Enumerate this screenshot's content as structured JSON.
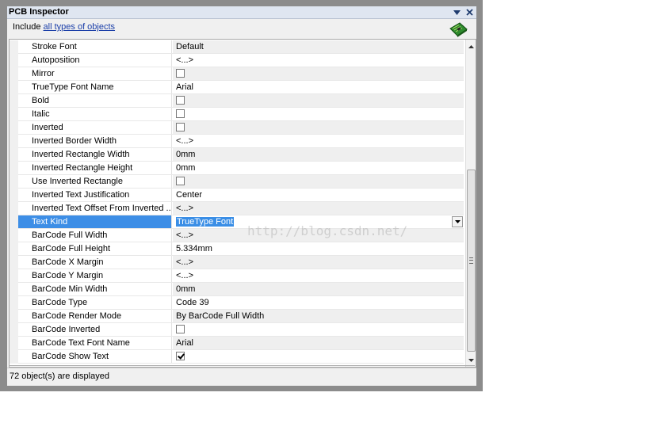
{
  "window": {
    "title": "PCB Inspector"
  },
  "include": {
    "prefix": "Include",
    "link": "all types of objects"
  },
  "icons": {
    "menu": "dropdown-arrow-icon",
    "close": "close-icon",
    "pcb": "pcb-board-icon"
  },
  "rows": [
    {
      "name": "Stroke Font",
      "value": "Default"
    },
    {
      "name": "Autoposition",
      "value": "<...>"
    },
    {
      "name": "Mirror",
      "check": false
    },
    {
      "name": "TrueType Font Name",
      "value": "Arial"
    },
    {
      "name": "Bold",
      "check": false
    },
    {
      "name": "Italic",
      "check": false
    },
    {
      "name": "Inverted",
      "check": false
    },
    {
      "name": "Inverted Border Width",
      "value": "<...>"
    },
    {
      "name": "Inverted Rectangle Width",
      "value": "0mm"
    },
    {
      "name": "Inverted Rectangle Height",
      "value": "0mm"
    },
    {
      "name": "Use Inverted Rectangle",
      "check": false
    },
    {
      "name": "Inverted Text Justification",
      "value": "Center"
    },
    {
      "name": "Inverted Text Offset From Inverted ...",
      "value": "<...>"
    },
    {
      "name": "Text Kind",
      "value": "TrueType Font",
      "selected": true
    },
    {
      "name": "BarCode Full Width",
      "value": "<...>"
    },
    {
      "name": "BarCode Full Height",
      "value": "5.334mm"
    },
    {
      "name": "BarCode X Margin",
      "value": "<...>"
    },
    {
      "name": "BarCode Y Margin",
      "value": "<...>"
    },
    {
      "name": "BarCode Min Width",
      "value": "0mm"
    },
    {
      "name": "BarCode Type",
      "value": "Code 39"
    },
    {
      "name": "BarCode Render Mode",
      "value": "By BarCode Full Width"
    },
    {
      "name": "BarCode Inverted",
      "check": false
    },
    {
      "name": "BarCode Text Font Name",
      "value": "Arial"
    },
    {
      "name": "BarCode Show Text",
      "check": true
    }
  ],
  "status": {
    "text": "72 object(s) are displayed"
  },
  "watermark": "http://blog.csdn.net/",
  "colors": {
    "selection": "#3d8ee6",
    "titlebar": "#dfe6f1",
    "link": "#1a3ea8"
  }
}
